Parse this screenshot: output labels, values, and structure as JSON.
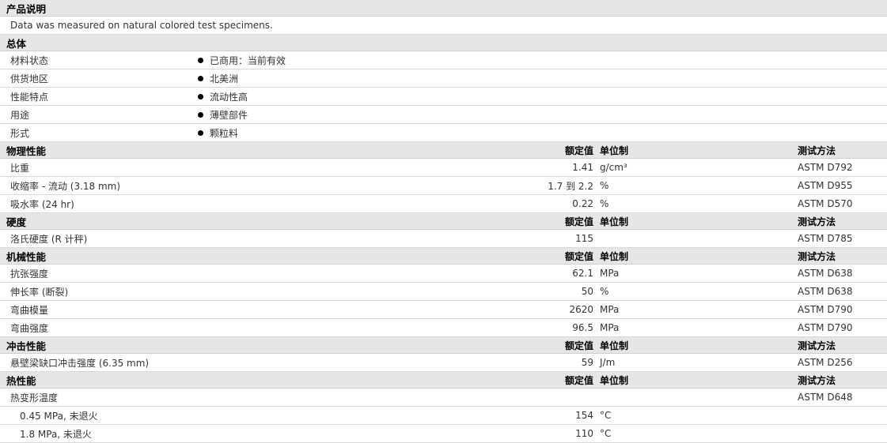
{
  "sections": {
    "description": {
      "title": "产品说明",
      "text": "Data was measured on natural colored test specimens."
    },
    "general": {
      "title": "总体",
      "rows": [
        {
          "label": "材料状态",
          "value": "已商用：当前有效"
        },
        {
          "label": "供货地区",
          "value": "北美洲"
        },
        {
          "label": "性能特点",
          "value": "流动性高"
        },
        {
          "label": "用途",
          "value": "薄壁部件"
        },
        {
          "label": "形式",
          "value": "颗粒料"
        }
      ]
    },
    "physical": {
      "title": "物理性能",
      "col_value": "额定值",
      "col_unit": "单位制",
      "col_method": "测试方法",
      "rows": [
        {
          "label": "比重",
          "value": "1.41",
          "unit": "g/cm³",
          "method": "ASTM D792"
        },
        {
          "label": "收缩率 - 流动 (3.18 mm)",
          "value": "1.7 到  2.2",
          "unit": "%",
          "method": "ASTM D955"
        },
        {
          "label": "吸水率 (24 hr)",
          "value": "0.22",
          "unit": "%",
          "method": "ASTM D570"
        }
      ]
    },
    "hardness": {
      "title": "硬度",
      "col_value": "额定值",
      "col_unit": "单位制",
      "col_method": "测试方法",
      "rows": [
        {
          "label": "洛氏硬度 (R 计秤)",
          "value": "115",
          "unit": "",
          "method": "ASTM D785"
        }
      ]
    },
    "mechanical": {
      "title": "机械性能",
      "col_value": "额定值",
      "col_unit": "单位制",
      "col_method": "测试方法",
      "rows": [
        {
          "label": "抗张强度",
          "value": "62.1",
          "unit": "MPa",
          "method": "ASTM D638"
        },
        {
          "label": "伸长率 (断裂)",
          "value": "50",
          "unit": "%",
          "method": "ASTM D638"
        },
        {
          "label": "弯曲模量",
          "value": "2620",
          "unit": "MPa",
          "method": "ASTM D790"
        },
        {
          "label": "弯曲强度",
          "value": "96.5",
          "unit": "MPa",
          "method": "ASTM D790"
        }
      ]
    },
    "impact": {
      "title": "冲击性能",
      "col_value": "额定值",
      "col_unit": "单位制",
      "col_method": "测试方法",
      "rows": [
        {
          "label": "悬壁梁缺口冲击强度 (6.35 mm)",
          "value": "59",
          "unit": "J/m",
          "method": "ASTM D256"
        }
      ]
    },
    "thermal": {
      "title": "热性能",
      "col_value": "额定值",
      "col_unit": "单位制",
      "col_method": "测试方法",
      "rows": [
        {
          "label": "热变形温度",
          "value": "",
          "unit": "",
          "method": "ASTM D648"
        },
        {
          "label": "0.45 MPa, 未退火",
          "value": "154",
          "unit": "°C",
          "method": ""
        },
        {
          "label": "1.8 MPa, 未退火",
          "value": "110",
          "unit": "°C",
          "method": ""
        }
      ]
    }
  }
}
